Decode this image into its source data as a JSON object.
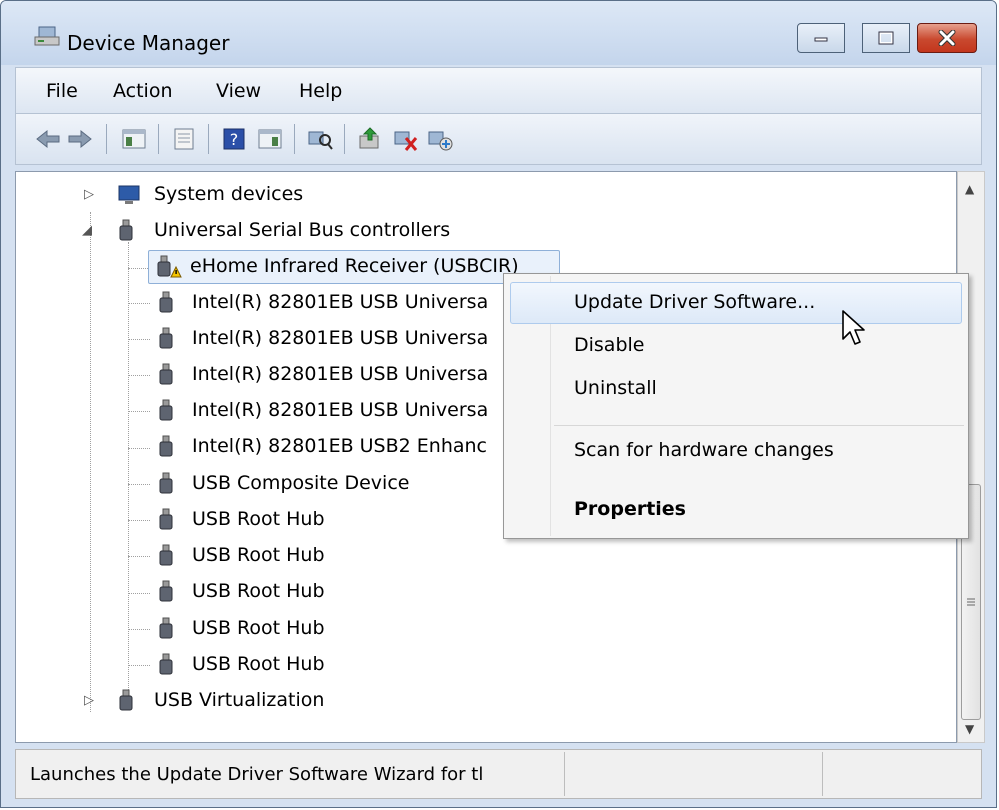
{
  "window": {
    "title": "Device Manager",
    "controls": [
      "minimize",
      "maximize",
      "close"
    ]
  },
  "menubar": {
    "items": [
      "File",
      "Action",
      "View",
      "Help"
    ]
  },
  "toolbar": {
    "icons": [
      "back-arrow-icon",
      "forward-arrow-icon",
      "show-hide-console-tree-icon",
      "properties-icon",
      "help-icon",
      "show-action-pane-icon",
      "scan-hardware-icon",
      "update-driver-icon",
      "uninstall-icon",
      "enable-device-icon"
    ]
  },
  "tree": {
    "system_devices": "System devices",
    "usb_controllers": "Universal Serial Bus controllers",
    "children": [
      "eHome Infrared Receiver (USBCIR)",
      "Intel(R) 82801EB USB Universa",
      "Intel(R) 82801EB USB Universa",
      "Intel(R) 82801EB USB Universa",
      "Intel(R) 82801EB USB Universa",
      "Intel(R) 82801EB USB2 Enhanc",
      "USB Composite Device",
      "USB Root Hub",
      "USB Root Hub",
      "USB Root Hub",
      "USB Root Hub",
      "USB Root Hub"
    ],
    "usb_virtualization": "USB Virtualization"
  },
  "context_menu": {
    "update_driver": "Update Driver Software...",
    "disable": "Disable",
    "uninstall": "Uninstall",
    "scan": "Scan for hardware changes",
    "properties": "Properties"
  },
  "status": {
    "text": "Launches the Update Driver Software Wizard for tl"
  },
  "colors": {
    "close_button": "#c9492f",
    "title_bar": "#c4d5ec",
    "menu_hover": "#dde9f8"
  }
}
